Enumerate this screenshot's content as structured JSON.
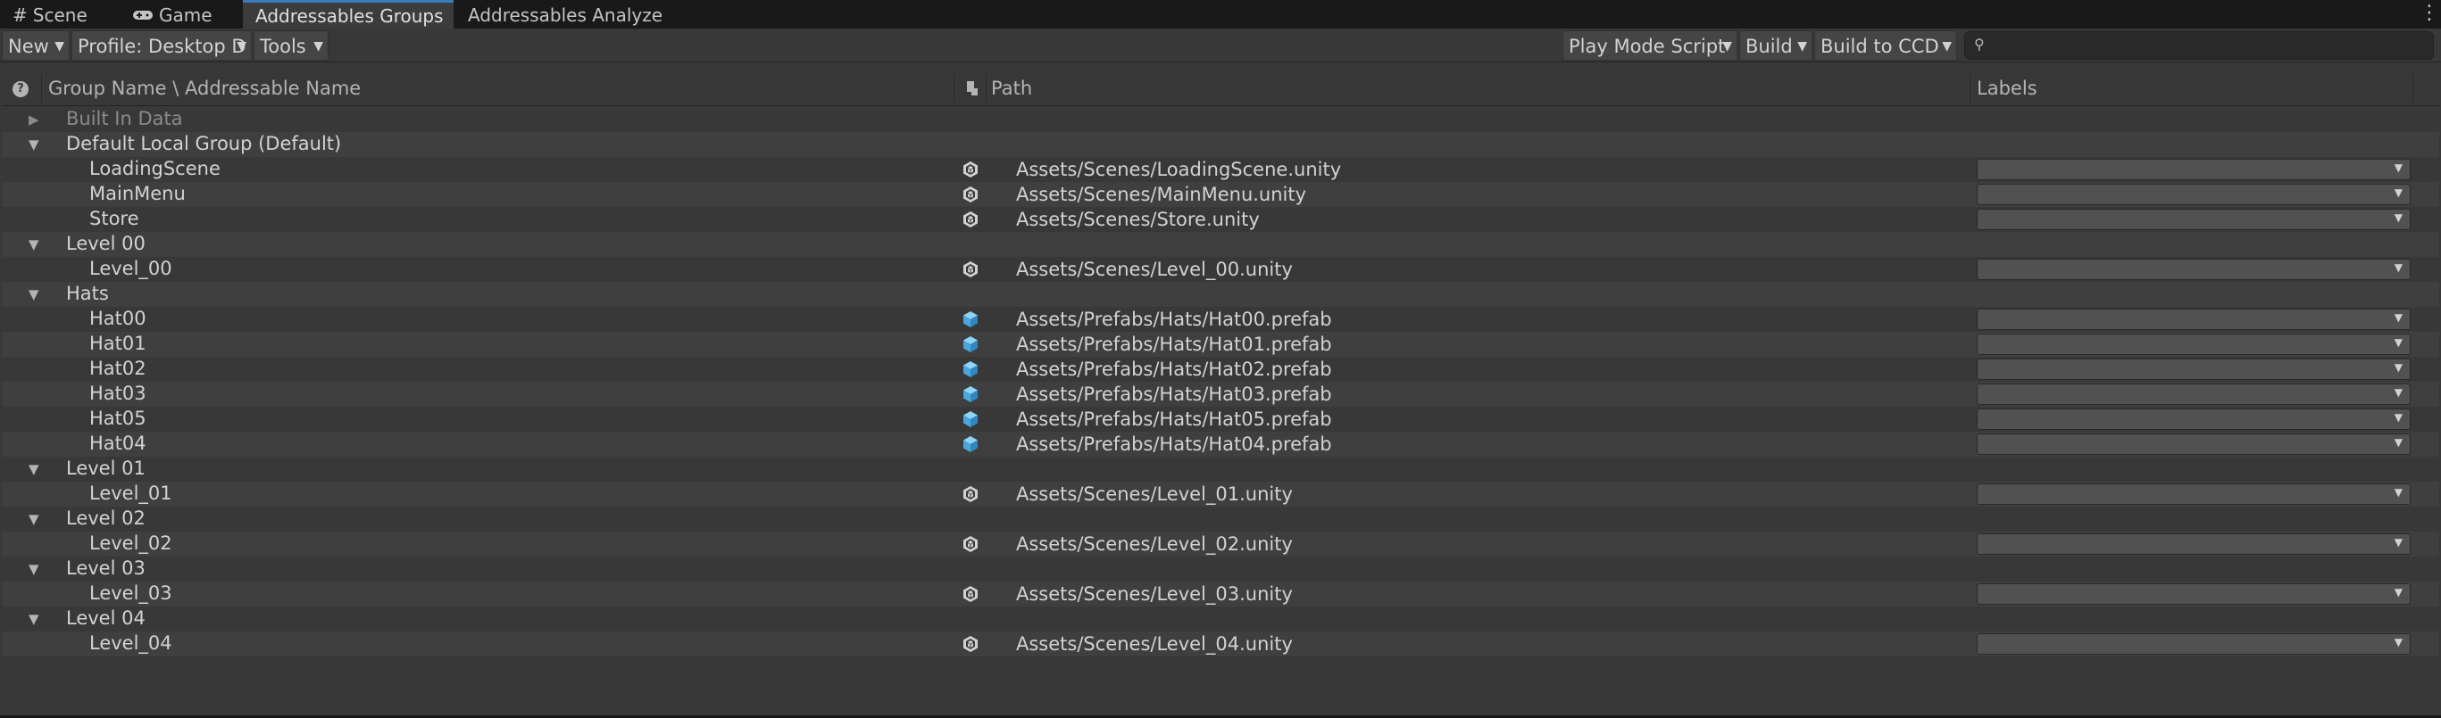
{
  "tabs": [
    {
      "label": "Scene",
      "icon": "grid-icon"
    },
    {
      "label": "Game",
      "icon": "gamepad-icon"
    },
    {
      "label": "Addressables Groups",
      "icon": ""
    },
    {
      "label": "Addressables Analyze",
      "icon": ""
    }
  ],
  "toolbar": {
    "new_label": "New",
    "profile_label": "Profile: Desktop D",
    "tools_label": "Tools",
    "play_mode_label": "Play Mode Script",
    "build_label": "Build",
    "build_ccd_label": "Build to CCD",
    "search_placeholder": ""
  },
  "columns": {
    "name": "Group Name \\ Addressable Name",
    "path": "Path",
    "labels": "Labels"
  },
  "colors": {
    "accent": "#3a79bb",
    "prefab_icon": "#5bb4e8",
    "scene_icon": "#d2d2d2"
  },
  "rows": [
    {
      "type": "group",
      "name": "Built In Data",
      "expanded": false,
      "dim": true
    },
    {
      "type": "group",
      "name": "Default Local Group (Default)",
      "expanded": true
    },
    {
      "type": "entry",
      "name": "LoadingScene",
      "path": "Assets/Scenes/LoadingScene.unity",
      "icon": "scene-icon"
    },
    {
      "type": "entry",
      "name": "MainMenu",
      "path": "Assets/Scenes/MainMenu.unity",
      "icon": "scene-icon"
    },
    {
      "type": "entry",
      "name": "Store",
      "path": "Assets/Scenes/Store.unity",
      "icon": "scene-icon"
    },
    {
      "type": "group",
      "name": "Level 00",
      "expanded": true
    },
    {
      "type": "entry",
      "name": "Level_00",
      "path": "Assets/Scenes/Level_00.unity",
      "icon": "scene-icon"
    },
    {
      "type": "group",
      "name": "Hats",
      "expanded": true
    },
    {
      "type": "entry",
      "name": "Hat00",
      "path": "Assets/Prefabs/Hats/Hat00.prefab",
      "icon": "prefab-icon"
    },
    {
      "type": "entry",
      "name": "Hat01",
      "path": "Assets/Prefabs/Hats/Hat01.prefab",
      "icon": "prefab-icon"
    },
    {
      "type": "entry",
      "name": "Hat02",
      "path": "Assets/Prefabs/Hats/Hat02.prefab",
      "icon": "prefab-icon"
    },
    {
      "type": "entry",
      "name": "Hat03",
      "path": "Assets/Prefabs/Hats/Hat03.prefab",
      "icon": "prefab-icon"
    },
    {
      "type": "entry",
      "name": "Hat05",
      "path": "Assets/Prefabs/Hats/Hat05.prefab",
      "icon": "prefab-icon"
    },
    {
      "type": "entry",
      "name": "Hat04",
      "path": "Assets/Prefabs/Hats/Hat04.prefab",
      "icon": "prefab-icon"
    },
    {
      "type": "group",
      "name": "Level 01",
      "expanded": true
    },
    {
      "type": "entry",
      "name": "Level_01",
      "path": "Assets/Scenes/Level_01.unity",
      "icon": "scene-icon"
    },
    {
      "type": "group",
      "name": "Level 02",
      "expanded": true
    },
    {
      "type": "entry",
      "name": "Level_02",
      "path": "Assets/Scenes/Level_02.unity",
      "icon": "scene-icon"
    },
    {
      "type": "group",
      "name": "Level 03",
      "expanded": true
    },
    {
      "type": "entry",
      "name": "Level_03",
      "path": "Assets/Scenes/Level_03.unity",
      "icon": "scene-icon"
    },
    {
      "type": "group",
      "name": "Level 04",
      "expanded": true
    },
    {
      "type": "entry",
      "name": "Level_04",
      "path": "Assets/Scenes/Level_04.unity",
      "icon": "scene-icon"
    }
  ]
}
